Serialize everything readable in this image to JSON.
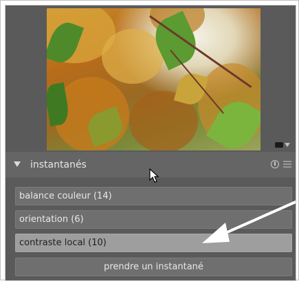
{
  "module": {
    "title": "instantanés",
    "collapse_icon": "triangle-down-icon",
    "reset_icon": "reset-icon",
    "menu_icon": "presets-menu-icon"
  },
  "snapshots": [
    {
      "label": "balance couleur (14)",
      "active": false
    },
    {
      "label": "orientation (6)",
      "active": false
    },
    {
      "label": "contraste local (10)",
      "active": true
    }
  ],
  "take_snapshot_label": "prendre un instantané",
  "colors": {
    "panel": "#5a5a5a",
    "item": "#6f6f6f",
    "item_active": "#9e9e9e",
    "annotation_arrow": "#ffffff"
  }
}
